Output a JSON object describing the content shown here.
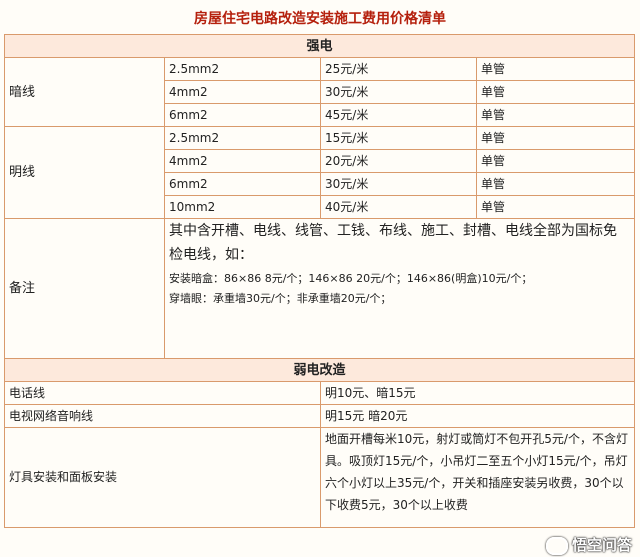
{
  "title": "房屋住宅电路改造安装施工费用价格清单",
  "section1": "强电",
  "concealed": {
    "label": "暗线",
    "rows": [
      {
        "spec": "2.5mm2",
        "price": "25元/米",
        "unit": "单管"
      },
      {
        "spec": "4mm2",
        "price": "30元/米",
        "unit": "单管"
      },
      {
        "spec": "6mm2",
        "price": "45元/米",
        "unit": "单管"
      }
    ]
  },
  "exposed": {
    "label": "明线",
    "rows": [
      {
        "spec": "2.5mm2",
        "price": "15元/米",
        "unit": "单管"
      },
      {
        "spec": "4mm2",
        "price": "20元/米",
        "unit": "单管"
      },
      {
        "spec": "6mm2",
        "price": "30元/米",
        "unit": "单管"
      },
      {
        "spec": "10mm2",
        "price": "40元/米",
        "unit": "单管"
      }
    ]
  },
  "remarks": {
    "label": "备注",
    "line1": "其中含开槽、电线、线管、工钱、布线、施工、封槽、电线全部为国标免检电线，如：",
    "line2": "安装暗盒：86×86 8元/个；146×86 20元/个；146×86(明盒)10元/个；",
    "line3": "穿墙眼：承重墙30元/个；非承重墙20元/个；"
  },
  "section2": "弱电改造",
  "phone": {
    "label": "电话线",
    "price": "明10元、暗15元"
  },
  "tv": {
    "label": "电视网络音响线",
    "price": "明15元 暗20元"
  },
  "lamp": {
    "label": "灯具安装和面板安装",
    "text": "地面开槽每米10元，射灯或筒灯不包开孔5元/个，不含灯具。吸顶灯15元/个，小吊灯二至五个小灯15元/个，吊灯六个小灯以上35元/个，开关和插座安装另收费，30个以下收费5元，30个以上收费"
  },
  "watermark": "悟空问答"
}
